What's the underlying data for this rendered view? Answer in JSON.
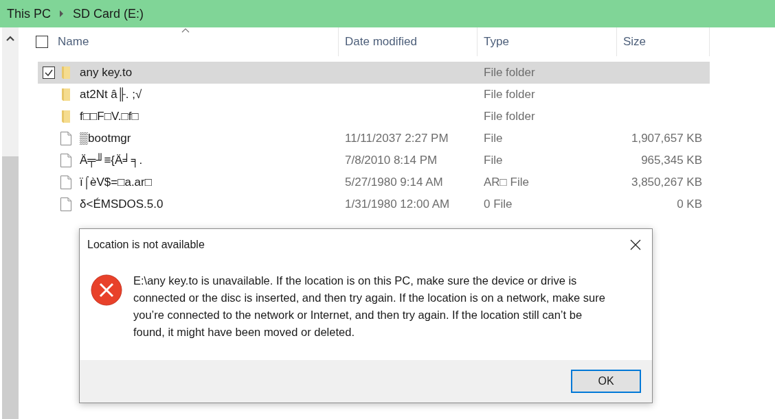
{
  "breadcrumb": [
    "This PC",
    "SD Card (E:)"
  ],
  "columns": [
    {
      "label": "Name",
      "sorted": true
    },
    {
      "label": "Date modified",
      "sorted": false
    },
    {
      "label": "Type",
      "sorted": false
    },
    {
      "label": "Size",
      "sorted": false
    }
  ],
  "select_all_checked": false,
  "files": [
    {
      "kind": "folder",
      "name": "any key.to",
      "type": "File folder",
      "selected": true
    },
    {
      "kind": "folder",
      "name": "at2Nt â╟. ;√",
      "type": "File folder",
      "selected": false
    },
    {
      "kind": "folder",
      "name": "f□□F□V.□f□",
      "type": "File folder",
      "selected": false
    },
    {
      "kind": "file",
      "name": "▒bootmgr",
      "date": "11/11/2037 2:27 PM",
      "type": "File",
      "size": "1,907,657 KB",
      "selected": false
    },
    {
      "kind": "file",
      "name": "Ä╤╜≡{Ä╛╕.",
      "date": "7/8/2010 8:14 PM",
      "type": "File",
      "size": "965,345 KB",
      "selected": false
    },
    {
      "kind": "file",
      "name": "ï⌠èV$=□a.ar□",
      "date": "5/27/1980 9:14 AM",
      "type": "AR□ File",
      "size": "3,850,267 KB",
      "selected": false
    },
    {
      "kind": "file",
      "name": "δ<ÉMSDOS.5.0",
      "date": "1/31/1980 12:00 AM",
      "type": "0 File",
      "size": "0 KB",
      "selected": false
    }
  ],
  "dialog": {
    "title": "Location is not available",
    "message": "E:\\any key.to is unavailable. If the location is on this PC, make sure the device or drive is connected or the disc is inserted, and then try again. If the location is on a network, make sure you’re connected to the network or Internet, and then try again. If the location still can’t be found, it might have been moved or deleted.",
    "button": "OK"
  }
}
